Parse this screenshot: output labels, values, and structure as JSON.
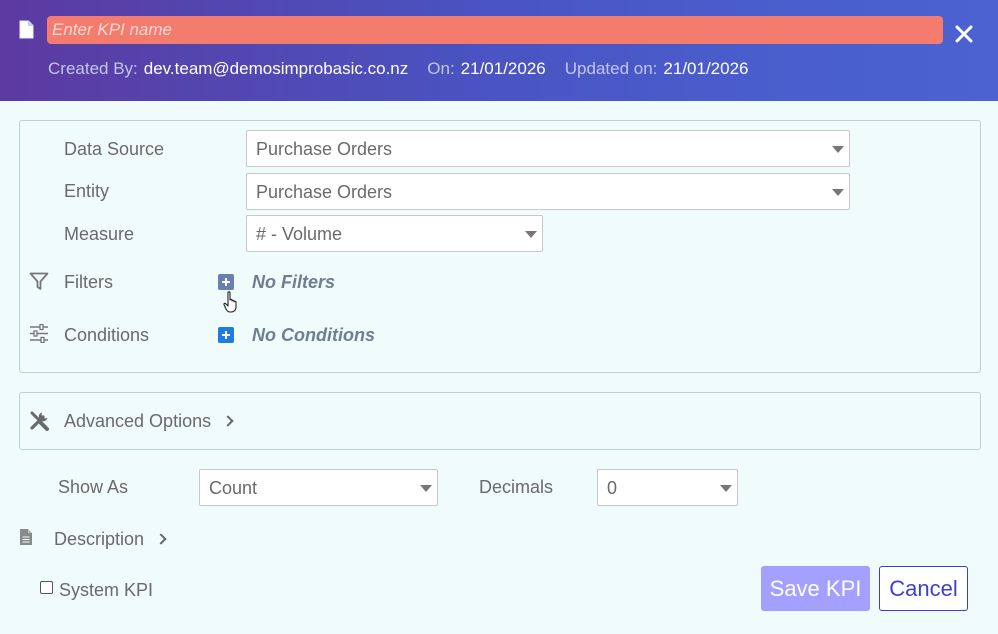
{
  "header": {
    "kpi_name_value": "",
    "kpi_name_placeholder": "Enter KPI name",
    "created_by_label": "Created By:",
    "created_by_value": "dev.team@demosimprobasic.co.nz",
    "on_label": "On:",
    "on_value": "21/01/2026",
    "updated_label": "Updated on:",
    "updated_value": "21/01/2026",
    "icons": {
      "document": "document-icon",
      "close": "close-icon"
    }
  },
  "config": {
    "data_source": {
      "label": "Data Source",
      "value": "Purchase Orders"
    },
    "entity": {
      "label": "Entity",
      "value": "Purchase Orders"
    },
    "measure": {
      "label": "Measure",
      "value": "# - Volume"
    },
    "filters": {
      "label": "Filters",
      "empty_text": "No Filters",
      "icon": "filter-icon"
    },
    "conditions": {
      "label": "Conditions",
      "empty_text": "No Conditions",
      "icon": "sliders-icon"
    }
  },
  "advanced": {
    "label": "Advanced Options",
    "icon": "tools-icon"
  },
  "show_as": {
    "label": "Show As",
    "value": "Count"
  },
  "decimals": {
    "label": "Decimals",
    "value": "0"
  },
  "description": {
    "label": "Description",
    "icon": "document-icon"
  },
  "system_kpi": {
    "label": "System KPI",
    "checked": false
  },
  "buttons": {
    "save": "Save KPI",
    "cancel": "Cancel"
  },
  "colors": {
    "header_gradient_start": "#5c3aa0",
    "header_gradient_end": "#4b62d0",
    "kpi_input_bg": "#f47c6e",
    "save_button": "#a3a0ff",
    "cancel_border": "#3d3fd4",
    "plus_filters": "#6b7fae",
    "plus_conditions": "#1f7be0",
    "page_bg": "#f0fbfb"
  }
}
